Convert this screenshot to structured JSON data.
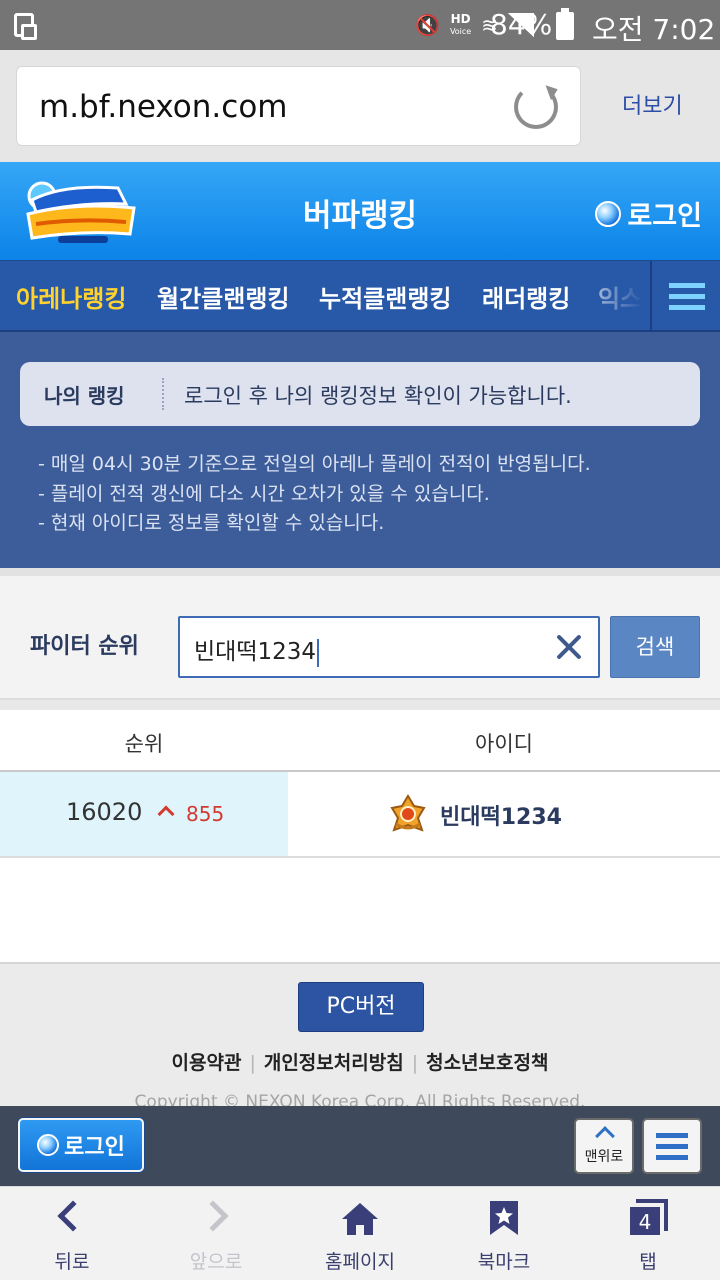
{
  "status_bar": {
    "icons": [
      "screen-icon",
      "mute-icon",
      "hd-voice-icon",
      "wifi-icon",
      "signal-icon",
      "battery-icon"
    ],
    "hd_label": "HD",
    "voice_label": "Voice",
    "battery": "84%",
    "time": "오전 7:02"
  },
  "browser": {
    "url": "m.bf.nexon.com",
    "more": "더보기"
  },
  "header": {
    "title": "버파랭킹",
    "login": "로그인"
  },
  "tabs": [
    {
      "label": "아레나랭킹",
      "active": true
    },
    {
      "label": "월간클랜랭킹",
      "active": false
    },
    {
      "label": "누적클랜랭킹",
      "active": false
    },
    {
      "label": "래더랭킹",
      "active": false
    },
    {
      "label": "익스",
      "active": false
    }
  ],
  "my_ranking": {
    "label": "나의 랭킹",
    "message": "로그인 후 나의 랭킹정보 확인이 가능합니다."
  },
  "notes": [
    "- 매일 04시 30분 기준으로 전일의 아레나 플레이 전적이 반영됩니다.",
    "- 플레이 전적 갱신에 다소 시간 오차가 있을 수 있습니다.",
    "- 현재 아이디로 정보를 확인할 수 있습니다."
  ],
  "search": {
    "label": "파이터 순위",
    "value": "빈대떡1234",
    "button": "검색"
  },
  "table": {
    "columns": [
      "순위",
      "아이디"
    ],
    "rows": [
      {
        "rank": "16020",
        "change": "855",
        "id": "빈대떡1234"
      }
    ]
  },
  "footer": {
    "pc_button": "PC버전",
    "links": [
      "이용약관",
      "개인정보처리방침",
      "청소년보호정책"
    ],
    "copyright": "Copyright © NEXON Korea Corp. All Rights Reserved."
  },
  "float_bar": {
    "login": "로그인",
    "top": "맨위로"
  },
  "bottom_nav": [
    {
      "label": "뒤로",
      "icon": "back-icon"
    },
    {
      "label": "앞으로",
      "icon": "forward-icon"
    },
    {
      "label": "홈페이지",
      "icon": "home-icon"
    },
    {
      "label": "북마크",
      "icon": "bookmark-icon"
    },
    {
      "label": "탭",
      "icon": "tabs-icon",
      "count": "4"
    }
  ],
  "colors": {
    "header_blue": "#0b83e8",
    "nav_blue": "#2858a8",
    "active_tab": "#ffd22e",
    "rank_up": "#d23a2f"
  }
}
